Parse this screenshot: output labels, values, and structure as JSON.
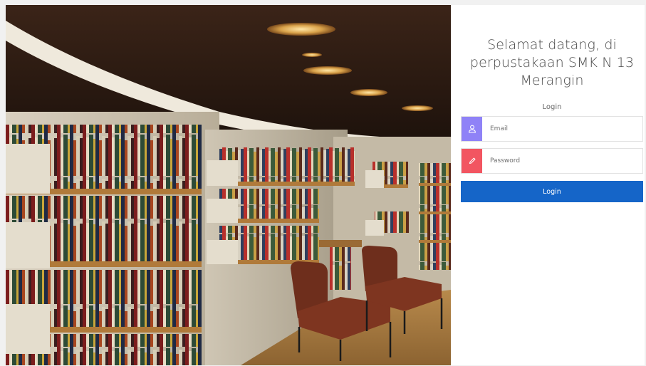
{
  "hero": {
    "image_icon": "library-bookshelves-photo"
  },
  "login": {
    "welcome_text": "Selamat datang, di perpustakaan SMK N 13 Merangin",
    "caption": "Login",
    "email": {
      "placeholder": "Email",
      "value": "",
      "icon": "user-icon",
      "icon_color": "#8f82f7"
    },
    "password": {
      "placeholder": "Password",
      "value": "",
      "icon": "pencil-icon",
      "icon_color": "#f25561"
    },
    "button_label": "Login",
    "button_color": "#1565c8"
  }
}
